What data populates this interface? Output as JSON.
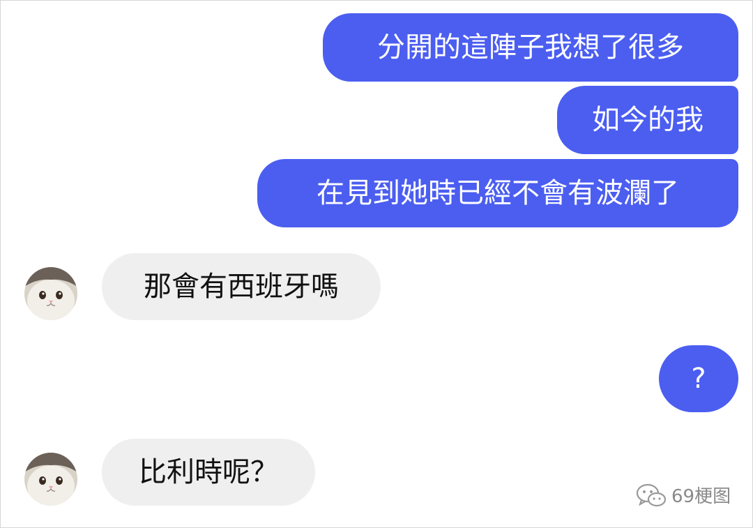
{
  "messages": [
    {
      "side": "sent",
      "text": "分開的這陣子我想了很多"
    },
    {
      "side": "sent",
      "text": "如今的我"
    },
    {
      "side": "sent",
      "text": "在見到她時已經不會有波瀾了"
    },
    {
      "side": "received",
      "text": "那會有西班牙嗎"
    },
    {
      "side": "sent",
      "text": "?"
    },
    {
      "side": "received",
      "text": "比利時呢？"
    }
  ],
  "watermark": {
    "text": "69梗图",
    "icon": "wechat-icon"
  },
  "colors": {
    "sent_bubble": "#4b5ef0",
    "received_bubble": "#efefef",
    "sent_text": "#ffffff",
    "received_text": "#111111"
  }
}
